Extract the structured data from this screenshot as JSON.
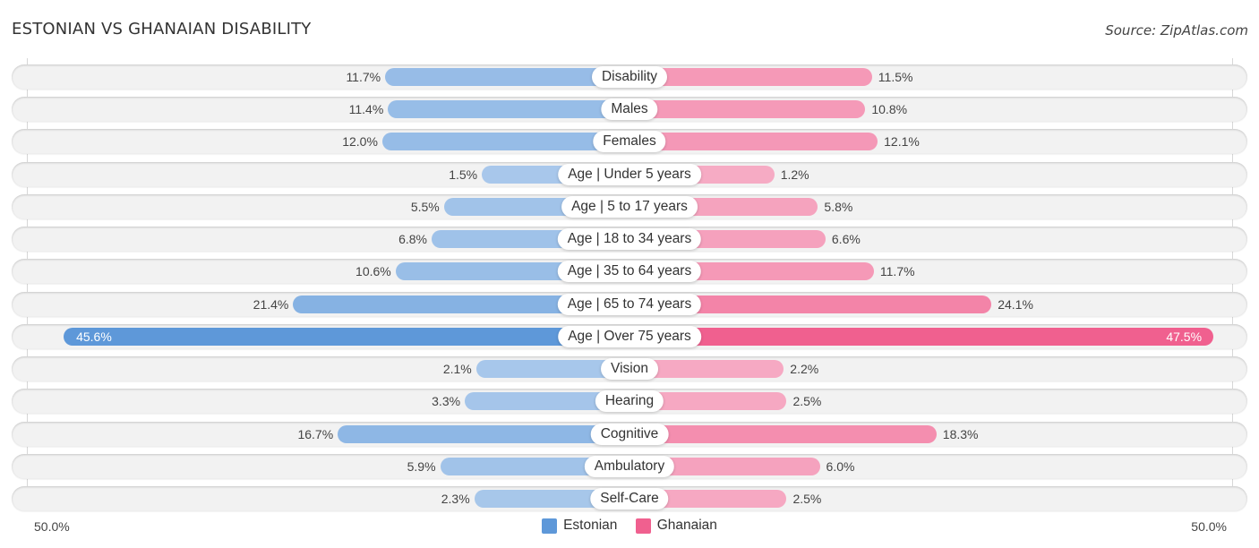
{
  "header": {
    "title": "ESTONIAN VS GHANAIAN DISABILITY",
    "source": "Source: ZipAtlas.com"
  },
  "colors": {
    "estonian_strong": "#5e98d9",
    "estonian_light": "#a9c8eb",
    "ghanaian_strong": "#f0608f",
    "ghanaian_light": "#f6abc4"
  },
  "axis": {
    "left_label": "50.0%",
    "right_label": "50.0%"
  },
  "legend": [
    {
      "name": "Estonian",
      "color": "#5e98d9"
    },
    {
      "name": "Ghanaian",
      "color": "#f0608f"
    }
  ],
  "chart_data": {
    "type": "bar",
    "orientation": "horizontal-diverging",
    "title": "ESTONIAN VS GHANAIAN DISABILITY",
    "xlim": [
      -50,
      50
    ],
    "xlabel": "",
    "ylabel": "",
    "legend_position": "bottom",
    "grid": false,
    "categories": [
      "Disability",
      "Males",
      "Females",
      "Age | Under 5 years",
      "Age | 5 to 17 years",
      "Age | 18 to 34 years",
      "Age | 35 to 64 years",
      "Age | 65 to 74 years",
      "Age | Over 75 years",
      "Vision",
      "Hearing",
      "Cognitive",
      "Ambulatory",
      "Self-Care"
    ],
    "series": [
      {
        "name": "Estonian",
        "side": "left",
        "values": [
          11.7,
          11.4,
          12.0,
          1.5,
          5.5,
          6.8,
          10.6,
          21.4,
          45.6,
          2.1,
          3.3,
          16.7,
          5.9,
          2.3
        ],
        "labels": [
          "11.7%",
          "11.4%",
          "12.0%",
          "1.5%",
          "5.5%",
          "6.8%",
          "10.6%",
          "21.4%",
          "45.6%",
          "2.1%",
          "3.3%",
          "16.7%",
          "5.9%",
          "2.3%"
        ]
      },
      {
        "name": "Ghanaian",
        "side": "right",
        "values": [
          11.5,
          10.8,
          12.1,
          1.2,
          5.8,
          6.6,
          11.7,
          24.1,
          47.5,
          2.2,
          2.5,
          18.3,
          6.0,
          2.5
        ],
        "labels": [
          "11.5%",
          "10.8%",
          "12.1%",
          "1.2%",
          "5.8%",
          "6.6%",
          "11.7%",
          "24.1%",
          "47.5%",
          "2.2%",
          "2.5%",
          "18.3%",
          "6.0%",
          "2.5%"
        ]
      }
    ]
  }
}
